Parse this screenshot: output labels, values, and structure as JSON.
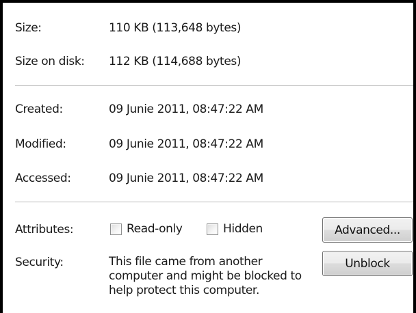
{
  "size": {
    "label": "Size:",
    "value": "110 KB (113,648 bytes)"
  },
  "size_on_disk": {
    "label": "Size on disk:",
    "value": "112 KB (114,688 bytes)"
  },
  "created": {
    "label": "Created:",
    "value": "09 Junie 2011, 08:47:22 AM"
  },
  "modified": {
    "label": "Modified:",
    "value": "09 Junie 2011, 08:47:22 AM"
  },
  "accessed": {
    "label": "Accessed:",
    "value": "09 Junie 2011, 08:47:22 AM"
  },
  "attributes": {
    "label": "Attributes:",
    "read_only": {
      "label": "Read-only",
      "checked": false
    },
    "hidden": {
      "label": "Hidden",
      "checked": false
    },
    "advanced_button": "Advanced..."
  },
  "security": {
    "label": "Security:",
    "message_lines": [
      "This file came from another",
      "computer and might be blocked to",
      "help protect this computer."
    ],
    "unblock_button": "Unblock"
  }
}
